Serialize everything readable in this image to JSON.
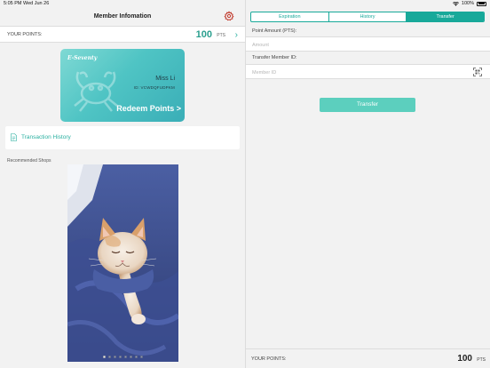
{
  "status": {
    "time": "5:05 PM",
    "date": "Wed Jun 26",
    "battery": "100%"
  },
  "left": {
    "title": "Member Infomation",
    "points_label": "YOUR POINTS:",
    "points_value": "100",
    "points_unit": "PTS",
    "card": {
      "brand": "E-Seventy",
      "name": "Miss Li",
      "member_id": "ID: VCWDQFUDPKM",
      "redeem": "Redeem Points >"
    },
    "transaction_history": "Transaction History",
    "recommended": "Recommended Shops",
    "carousel": {
      "total": 8,
      "active": 0
    }
  },
  "right": {
    "tabs": [
      {
        "label": "Expiration",
        "active": false
      },
      {
        "label": "History",
        "active": false
      },
      {
        "label": "Transfer",
        "active": true
      }
    ],
    "amount_label": "Point Amount (PTS):",
    "amount_placeholder": "Amount",
    "member_label": "Transfer Member ID:",
    "member_placeholder": "Member ID",
    "transfer_button": "Transfer",
    "footer_label": "YOUR POINTS:",
    "footer_value": "100",
    "footer_unit": "PTS"
  },
  "colors": {
    "accent": "#18a99a",
    "button": "#5ccfbe",
    "gear": "#c0392b"
  }
}
